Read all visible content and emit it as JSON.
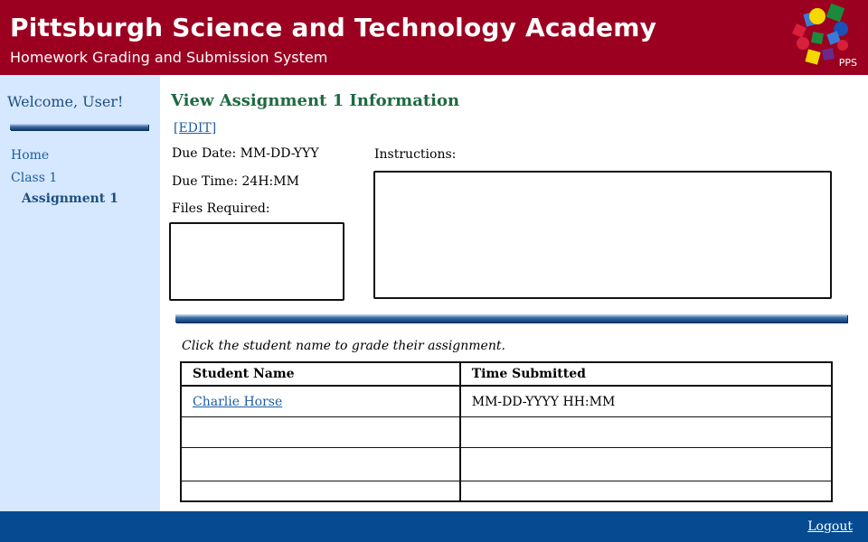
{
  "header": {
    "title": "Pittsburgh Science and Technology Academy",
    "subtitle": "Homework Grading and Submission System",
    "logo_text": "PPS",
    "brand_color": "#9b0020"
  },
  "sidebar": {
    "welcome": "Welcome, User!",
    "items": [
      {
        "label": "Home"
      },
      {
        "label": "Class 1"
      },
      {
        "label": "Assignment 1"
      }
    ],
    "background_color": "#d6e8ff"
  },
  "main": {
    "title": "View Assignment 1 Information",
    "edit_label": "[EDIT]",
    "due_date": "Due Date: MM-DD-YYY",
    "due_time": "Due Time: 24H:MM",
    "files_required": "Files Required:",
    "instructions": "Instructions:",
    "hint": "Click the student name to grade their assignment.",
    "table": {
      "headers": [
        "Student Name",
        "Time Submitted"
      ],
      "rows": [
        {
          "student": "Charlie Horse",
          "time": "MM-DD-YYYY HH:MM"
        },
        {
          "student": "",
          "time": ""
        },
        {
          "student": "",
          "time": ""
        },
        {
          "student": "",
          "time": ""
        }
      ]
    }
  },
  "footer": {
    "logout": "Logout",
    "background_color": "#064a91"
  }
}
